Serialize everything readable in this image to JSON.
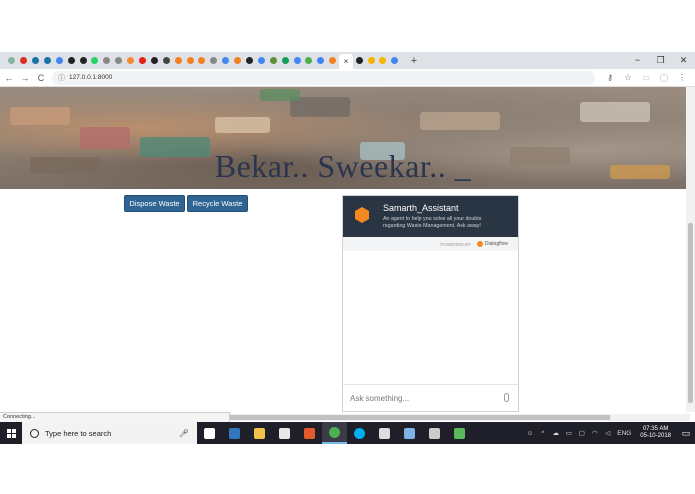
{
  "browser": {
    "tabs": [
      {
        "icon": "tab-icon",
        "color": "#8ab4a0"
      },
      {
        "icon": "gmail-icon",
        "color": "#d93025"
      },
      {
        "icon": "circle-icon",
        "color": "#1a73a8"
      },
      {
        "icon": "circle-icon",
        "color": "#1a73a8"
      },
      {
        "icon": "docs-icon",
        "color": "#4285f4"
      },
      {
        "icon": "circle-icon",
        "color": "#222"
      },
      {
        "icon": "github-icon",
        "color": "#222"
      },
      {
        "icon": "whatsapp-icon",
        "color": "#25d366"
      },
      {
        "icon": "page-icon",
        "color": "#888"
      },
      {
        "icon": "page-icon",
        "color": "#888"
      },
      {
        "icon": "circle-icon",
        "color": "#f28b30"
      },
      {
        "icon": "youtube-icon",
        "color": "#e62117"
      },
      {
        "icon": "circle-icon",
        "color": "#222"
      },
      {
        "icon": "page-icon",
        "color": "#444"
      },
      {
        "icon": "stack-icon",
        "color": "#f48024"
      },
      {
        "icon": "stack-icon",
        "color": "#f48024"
      },
      {
        "icon": "stack-icon",
        "color": "#f48024"
      },
      {
        "icon": "circle-icon",
        "color": "#888"
      },
      {
        "icon": "google-icon",
        "color": "#4285f4"
      },
      {
        "icon": "stack-icon",
        "color": "#f48024"
      },
      {
        "icon": "github-icon",
        "color": "#222"
      },
      {
        "icon": "google-icon",
        "color": "#4285f4"
      },
      {
        "icon": "bucket-icon",
        "color": "#5f8f3a"
      },
      {
        "icon": "sheet-icon",
        "color": "#0f9d58"
      },
      {
        "icon": "google-icon",
        "color": "#4285f4"
      },
      {
        "icon": "circle-icon",
        "color": "#4caf50"
      },
      {
        "icon": "google-icon",
        "color": "#4285f4"
      },
      {
        "icon": "stack-icon",
        "color": "#f48024"
      }
    ],
    "after_tabs": [
      {
        "icon": "github-icon",
        "color": "#222"
      },
      {
        "icon": "slides-icon",
        "color": "#f4b400"
      },
      {
        "icon": "slides-icon",
        "color": "#f4b400"
      },
      {
        "icon": "google-icon",
        "color": "#4285f4"
      }
    ],
    "active_tab_close": "×",
    "new_tab": "+",
    "window_controls": {
      "minimize": "−",
      "restore": "❐",
      "close": "✕"
    },
    "nav": {
      "back": "←",
      "forward": "→",
      "reload": "C"
    },
    "url": "127.0.0.1:8000",
    "info_icon": "ⓘ",
    "toolbar_icons": {
      "key": "⚷",
      "star": "☆",
      "menu": "⋮"
    }
  },
  "hero": {
    "title": "Bekar.. Sweekar.. _"
  },
  "actions": {
    "dispose_label": "Dispose Waste",
    "recycle_label": "Recycle Waste"
  },
  "chat": {
    "bot_name": "Samarth_Assistant",
    "description": "An agent to help you solve all your doubts regarding Waste Management. Ask away!",
    "powered_by": "POWERED BY",
    "powered_name": "Dialogflow",
    "input_placeholder": "Ask something..."
  },
  "status": {
    "text": "Connecting..."
  },
  "taskbar": {
    "search_placeholder": "Type here to search",
    "apps": [
      {
        "name": "task-view-icon",
        "color": "#ffffff"
      },
      {
        "name": "edge-icon",
        "color": "#3277bc"
      },
      {
        "name": "explorer-icon",
        "color": "#f0c24b"
      },
      {
        "name": "store-icon",
        "color": "#e8e8e8"
      },
      {
        "name": "app-icon",
        "color": "#e35b2c"
      },
      {
        "name": "chrome-icon",
        "color": "#4caf50"
      },
      {
        "name": "skype-icon",
        "color": "#00aff0"
      },
      {
        "name": "app-icon",
        "color": "#dddddd"
      },
      {
        "name": "app-icon",
        "color": "#7fb2e5"
      },
      {
        "name": "terminal-icon",
        "color": "#cccccc"
      },
      {
        "name": "app-icon",
        "color": "#5cb85c"
      }
    ],
    "tray_language": "ENG",
    "clock_time": "07:35 AM",
    "clock_date": "05-10-2018"
  }
}
